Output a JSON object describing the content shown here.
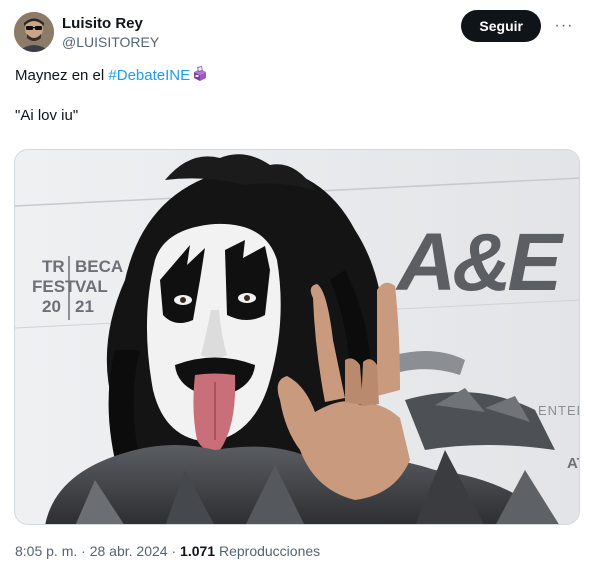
{
  "author": {
    "display_name": "Luisito Rey",
    "handle": "@LUISITOREY"
  },
  "actions": {
    "follow_label": "Seguir",
    "more_label": "···"
  },
  "tweet": {
    "line1_prefix": "Maynez en el ",
    "hashtag": "#DebateINE",
    "line2": "\"Ai lov iu\""
  },
  "media": {
    "backdrop_lines": [
      "TR",
      "BECA",
      "FEST",
      "VAL",
      "20",
      "21"
    ],
    "brand_logo": "A&E",
    "side_text": "ENTED",
    "side_text2": "AT"
  },
  "meta": {
    "time": "8:05 p. m.",
    "separator": " · ",
    "date": "28 abr. 2024",
    "views_count": "1.071",
    "views_label": " Reproducciones"
  },
  "colors": {
    "link": "#1d9bf0",
    "button_bg": "#0f1419",
    "secondary_text": "#536471"
  },
  "icons": [
    "ballot-box-icon",
    "more-options-icon"
  ]
}
